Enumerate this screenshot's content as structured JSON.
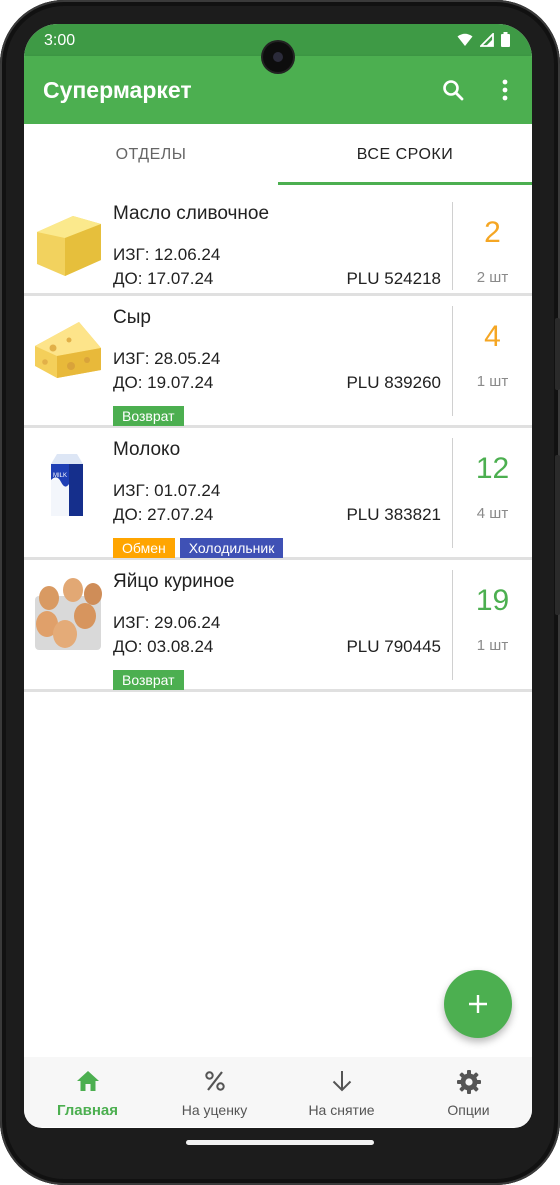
{
  "status_bar": {
    "time": "3:00",
    "icons": [
      "wifi-icon",
      "signal-icon",
      "battery-icon"
    ]
  },
  "app_bar": {
    "title": "Супермаркет",
    "actions": [
      "search-icon",
      "more-vert-icon"
    ]
  },
  "tabs": [
    {
      "label": "ОТДЕЛЫ",
      "active": false
    },
    {
      "label": "ВСЕ СРОКИ",
      "active": true
    }
  ],
  "products": [
    {
      "name": "Масло сливочное",
      "made": "ИЗГ: 12.06.24",
      "until": "ДО: 17.07.24",
      "plu": "PLU 524218",
      "days": "2",
      "qty": "2 шт",
      "days_color": "#f5a623",
      "image": "butter-image",
      "tags": []
    },
    {
      "name": "Сыр",
      "made": "ИЗГ: 28.05.24",
      "until": "ДО: 19.07.24",
      "plu": "PLU 839260",
      "days": "4",
      "qty": "1 шт",
      "days_color": "#f5a623",
      "image": "cheese-image",
      "tags": [
        {
          "label": "Возврат",
          "color": "#4caf50"
        }
      ]
    },
    {
      "name": "Молоко",
      "made": "ИЗГ: 01.07.24",
      "until": "ДО: 27.07.24",
      "plu": "PLU 383821",
      "days": "12",
      "qty": "4 шт",
      "days_color": "#4caf50",
      "image": "milk-carton-image",
      "tags": [
        {
          "label": "Обмен",
          "color": "#ffa500"
        },
        {
          "label": "Холодильник",
          "color": "#3f51b5"
        }
      ]
    },
    {
      "name": "Яйцо куриное",
      "made": "ИЗГ: 29.06.24",
      "until": "ДО: 03.08.24",
      "plu": "PLU 790445",
      "days": "19",
      "qty": "1 шт",
      "days_color": "#4caf50",
      "image": "eggs-image",
      "tags": [
        {
          "label": "Возврат",
          "color": "#4caf50"
        }
      ]
    }
  ],
  "fab": {
    "icon": "plus-icon"
  },
  "bottom_nav": [
    {
      "label": "Главная",
      "icon": "home-icon",
      "active": true
    },
    {
      "label": "На уценку",
      "icon": "percent-icon",
      "active": false
    },
    {
      "label": "На снятие",
      "icon": "arrow-down-icon",
      "active": false
    },
    {
      "label": "Опции",
      "icon": "settings-icon",
      "active": false
    }
  ],
  "colors": {
    "primary": "#4caf50",
    "primary_dark": "#3e9a45",
    "warning": "#f5a623",
    "blue_tag": "#3f51b5"
  }
}
